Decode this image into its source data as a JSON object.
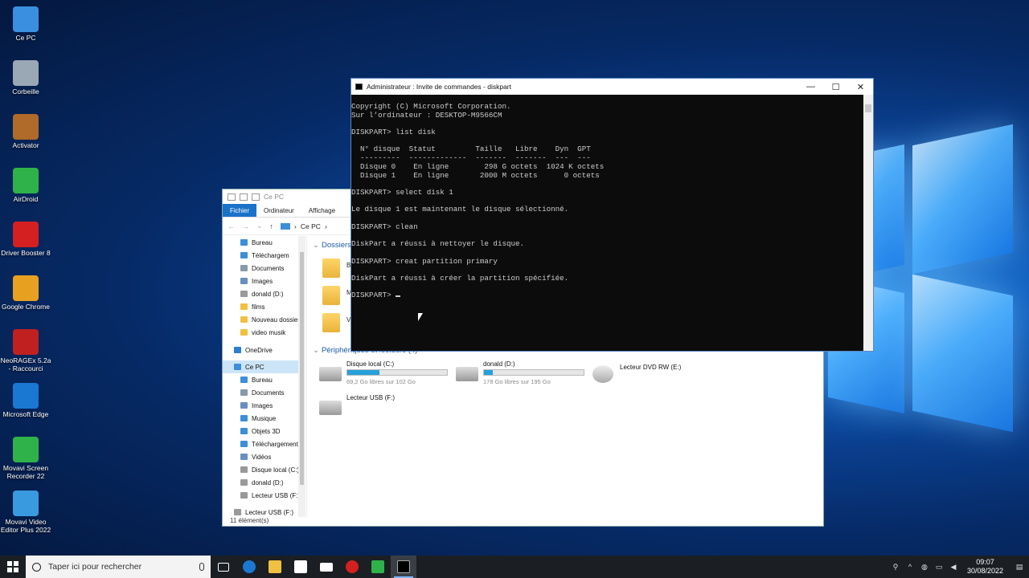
{
  "desktop": {
    "icons": [
      {
        "label": "Ce PC",
        "icon": "computer-icon",
        "color": "#3a8fe0"
      },
      {
        "label": "Corbeille",
        "icon": "recycle-bin-icon",
        "color": "#9aa7b5"
      },
      {
        "label": "Activator",
        "icon": "archive-icon",
        "color": "#b06a2a"
      },
      {
        "label": "AirDroid",
        "icon": "airdroid-icon",
        "color": "#2fb24a"
      },
      {
        "label": "Driver Booster 8",
        "icon": "driver-booster-icon",
        "color": "#d42020"
      },
      {
        "label": "Google Chrome",
        "icon": "chrome-icon",
        "color": "#e8a020"
      },
      {
        "label": "NeoRAGEx 5.2a - Raccourci",
        "icon": "neoragex-icon",
        "color": "#c02020"
      },
      {
        "label": "Microsoft Edge",
        "icon": "edge-icon",
        "color": "#1a78d2"
      },
      {
        "label": "Movavi Screen Recorder 22",
        "icon": "movavi-recorder-icon",
        "color": "#2fb24a"
      },
      {
        "label": "Movavi Video Editor Plus 2022",
        "icon": "movavi-editor-icon",
        "color": "#3a9ae0"
      }
    ]
  },
  "cmd": {
    "title": "Administrateur : Invite de commandes - diskpart",
    "lines": [
      "Copyright (C) Microsoft Corporation.",
      "Sur l’ordinateur : DESKTOP-M9566CM",
      "",
      "DISKPART> list disk",
      "",
      "  N° disque  Statut         Taille   Libre    Dyn  GPT",
      "  ---------  -------------  -------  -------  ---  ---",
      "  Disque 0    En ligne        298 G octets  1024 K octets",
      "  Disque 1    En ligne       2000 M octets      0 octets",
      "",
      "DISKPART> select disk 1",
      "",
      "Le disque 1 est maintenant le disque sélectionné.",
      "",
      "DISKPART> clean",
      "",
      "DiskPart a réussi à nettoyer le disque.",
      "",
      "DISKPART> creat partition primary",
      "",
      "DiskPart a réussi à créer la partition spécifiée.",
      ""
    ],
    "prompt": "DISKPART> "
  },
  "explorer": {
    "title": "Ce PC",
    "tabs": [
      "Fichier",
      "Ordinateur",
      "Affichage"
    ],
    "address": "Ce PC",
    "nav": [
      {
        "label": "Bureau",
        "icon": "desktop-folder-icon",
        "color": "#3b8fd9"
      },
      {
        "label": "Téléchargem",
        "icon": "download-icon",
        "color": "#3b8fd9"
      },
      {
        "label": "Documents",
        "icon": "documents-icon",
        "color": "#8899aa"
      },
      {
        "label": "Images",
        "icon": "images-icon",
        "color": "#6a8fbf"
      },
      {
        "label": "donald (D:)",
        "icon": "drive-icon",
        "color": "#999999"
      },
      {
        "label": "films",
        "icon": "folder-icon",
        "color": "#f0c040"
      },
      {
        "label": "Nouveau dossier",
        "icon": "folder-icon",
        "color": "#f0c040"
      },
      {
        "label": "video musik",
        "icon": "folder-icon",
        "color": "#f0c040"
      }
    ],
    "onedrive": "OneDrive",
    "thispc": "Ce PC",
    "pc_items": [
      {
        "label": "Bureau",
        "icon": "desktop-folder-icon",
        "color": "#3b8fd9"
      },
      {
        "label": "Documents",
        "icon": "documents-icon",
        "color": "#8899aa"
      },
      {
        "label": "Images",
        "icon": "images-icon",
        "color": "#6a8fbf"
      },
      {
        "label": "Musique",
        "icon": "music-icon",
        "color": "#3b8fd9"
      },
      {
        "label": "Objets 3D",
        "icon": "objects3d-icon",
        "color": "#3b8fd9"
      },
      {
        "label": "Téléchargement",
        "icon": "download-icon",
        "color": "#3b8fd9"
      },
      {
        "label": "Vidéos",
        "icon": "videos-icon",
        "color": "#6a8fbf"
      },
      {
        "label": "Disque local (C:)",
        "icon": "drive-icon",
        "color": "#999999"
      },
      {
        "label": "donald (D:)",
        "icon": "drive-icon",
        "color": "#999999"
      },
      {
        "label": "Lecteur USB (F:)",
        "icon": "usb-drive-icon",
        "color": "#999999"
      }
    ],
    "usb_bottom": "Lecteur USB (F:)",
    "section_folders": "Dossiers",
    "folder_initials": [
      "B",
      "M",
      "V"
    ],
    "section_devices": "Périphériques et lecteurs (4)",
    "drives": [
      {
        "name": "Disque local (C:)",
        "sub": "69,2 Go libres sur 102 Go",
        "used": 0.32
      },
      {
        "name": "donald (D:)",
        "sub": "178 Go libres sur 195 Go",
        "used": 0.09
      }
    ],
    "dvd": "Lecteur DVD RW (E:)",
    "usb": "Lecteur USB (F:)",
    "status": "11 élément(s)"
  },
  "taskbar": {
    "search_placeholder": "Taper ici pour rechercher",
    "time": "09:07",
    "date": "30/08/2022"
  }
}
